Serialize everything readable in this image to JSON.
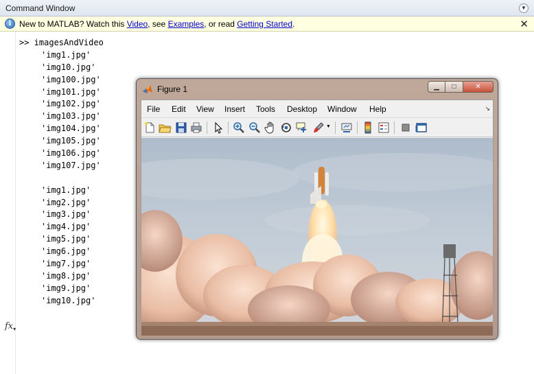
{
  "command_window": {
    "title": "Command Window",
    "menu_glyph": "▼"
  },
  "infobar": {
    "prefix": "New to MATLAB? Watch this ",
    "video_link": "Video",
    "mid1": ", see ",
    "examples_link": "Examples",
    "mid2": ", or read ",
    "getting_started_link": "Getting Started",
    "suffix": ".",
    "close_glyph": "✕"
  },
  "console": {
    "prompt_line": ">> imagesAndVideo",
    "output_block_1": [
      "'img1.jpg'",
      "'img10.jpg'",
      "'img100.jpg'",
      "'img101.jpg'",
      "'img102.jpg'",
      "'img103.jpg'",
      "'img104.jpg'",
      "'img105.jpg'",
      "'img106.jpg'",
      "'img107.jpg'"
    ],
    "output_block_2": [
      "'img1.jpg'",
      "'img2.jpg'",
      "'img3.jpg'",
      "'img4.jpg'",
      "'img5.jpg'",
      "'img6.jpg'",
      "'img7.jpg'",
      "'img8.jpg'",
      "'img9.jpg'",
      "'img10.jpg'"
    ],
    "fx_label": "fx"
  },
  "figure": {
    "title": "Figure 1",
    "window_buttons": {
      "minimize": "▁",
      "maximize": "□",
      "close": "✕"
    },
    "menus": [
      "File",
      "Edit",
      "View",
      "Insert",
      "Tools",
      "Desktop",
      "Window",
      "Help"
    ],
    "toolbar_icons": [
      "new-figure-icon",
      "open-file-icon",
      "save-icon",
      "print-icon",
      "edit-plot-arrow-icon",
      "zoom-in-icon",
      "zoom-out-icon",
      "pan-hand-icon",
      "rotate-3d-icon",
      "data-cursor-icon",
      "brush-icon",
      "link-plot-icon",
      "colorbar-icon",
      "legend-icon",
      "hide-plot-tools-icon",
      "show-plot-tools-icon"
    ],
    "image_subject": "space-shuttle-launch"
  },
  "colors": {
    "info_bg": "#ffffe1",
    "link": "#0000cc",
    "figure_frame": "#b49a8c"
  }
}
